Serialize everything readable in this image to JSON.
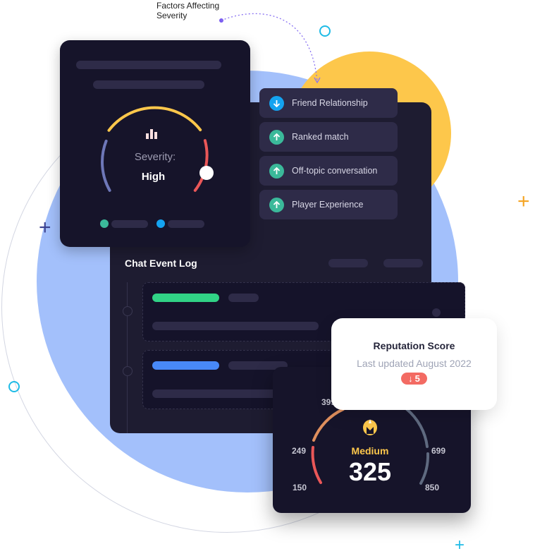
{
  "annotation": {
    "label_line1": "Factors Affecting",
    "label_line2": "Severity"
  },
  "severity_card": {
    "label": "Severity:",
    "value": "High",
    "level_fraction": 0.8,
    "icon": "bar-chart-icon",
    "legend_dot_colors": [
      "#3bb99a",
      "#14a3f0"
    ]
  },
  "factors": [
    {
      "label": "Friend Relationship",
      "direction": "down",
      "icon": "arrow-down-icon",
      "color": "#14a3f0"
    },
    {
      "label": "Ranked match",
      "direction": "up",
      "icon": "arrow-up-icon",
      "color": "#3bb99a"
    },
    {
      "label": "Off-topic conversation",
      "direction": "up",
      "icon": "arrow-up-icon",
      "color": "#3bb99a"
    },
    {
      "label": "Player Experience",
      "direction": "up",
      "icon": "arrow-up-icon",
      "color": "#3bb99a"
    }
  ],
  "chat_log": {
    "title": "Chat Event Log",
    "events": [
      {
        "tag_color": "#31d386"
      },
      {
        "tag_color": "#4889f8"
      }
    ]
  },
  "reputation": {
    "title": "Reputation Score",
    "subtitle": "Last updated August 2022",
    "change_arrow": "↓",
    "change_value": "5",
    "change_color": "#f36b63"
  },
  "score_gauge": {
    "level": "Medium",
    "score": "325",
    "icon": "helmet-icon",
    "ticks": [
      "150",
      "249",
      "399",
      "699",
      "850"
    ],
    "range": [
      150,
      850
    ]
  },
  "colors": {
    "dark_panel": "#16142a",
    "accent_yellow": "#fdc74b",
    "accent_blue_bg": "#a3c0fb",
    "gauge_red": "#ea5758",
    "gauge_orange": "#df8f5d",
    "gauge_gray": "#5f6a80",
    "gauge_periwinkle": "#6e77b8"
  }
}
